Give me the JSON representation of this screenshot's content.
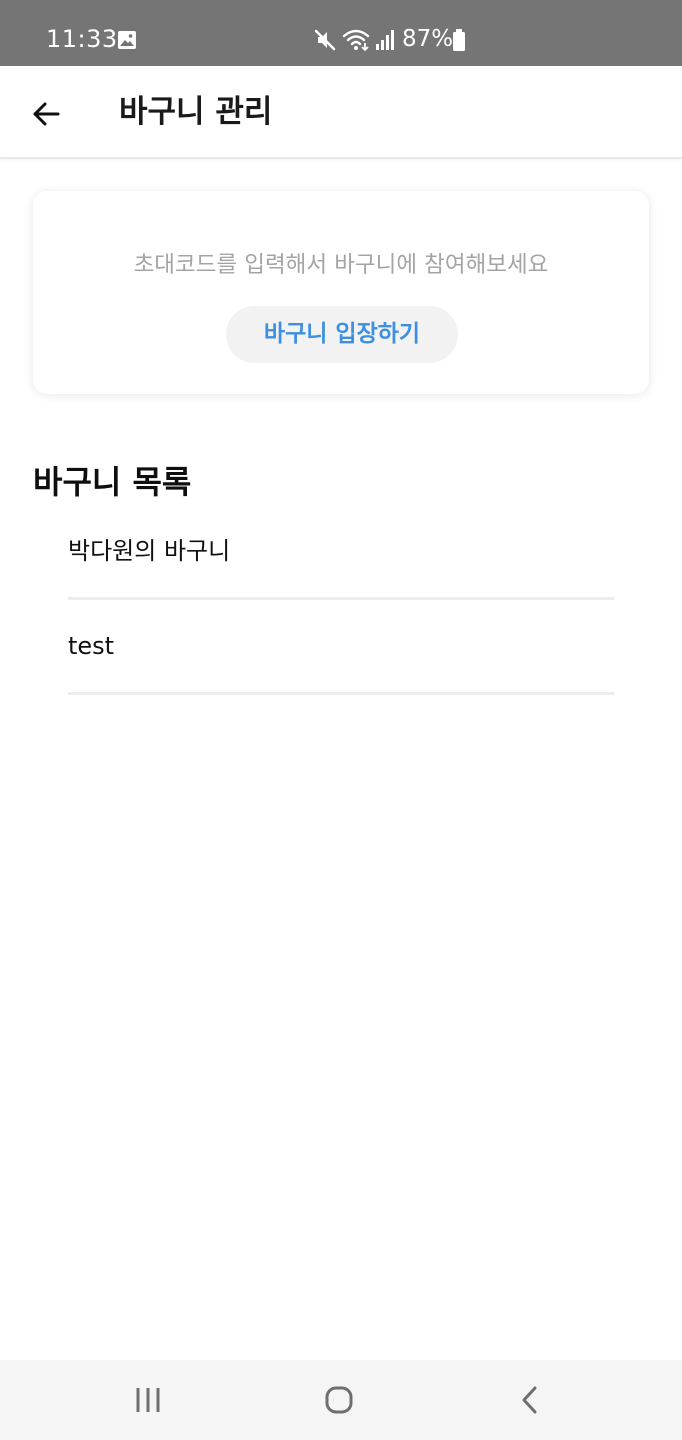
{
  "status_bar": {
    "time": "11:33",
    "battery": "87%",
    "icons": [
      "image-icon",
      "mute-icon",
      "wifi-icon",
      "signal-icon",
      "battery-icon"
    ]
  },
  "app_bar": {
    "title": "바구니 관리",
    "back_icon": "arrow-left-icon"
  },
  "invite_card": {
    "message": "초대코드를 입력해서 바구니에 참여해보세요",
    "button_label": "바구니 입장하기"
  },
  "basket_section": {
    "title": "바구니 목록",
    "items": [
      {
        "label": "박다원의 바구니"
      },
      {
        "label": "test"
      }
    ]
  },
  "nav_bar": {
    "icons": [
      "recents-icon",
      "home-icon",
      "back-icon"
    ]
  },
  "colors": {
    "status_bar_bg": "#757575",
    "accent": "#3f8fe0",
    "hint_text": "#a4a4a4",
    "button_bg": "#f2f2f2",
    "divider": "#ededed",
    "nav_bar_bg": "#f5f5f5"
  }
}
